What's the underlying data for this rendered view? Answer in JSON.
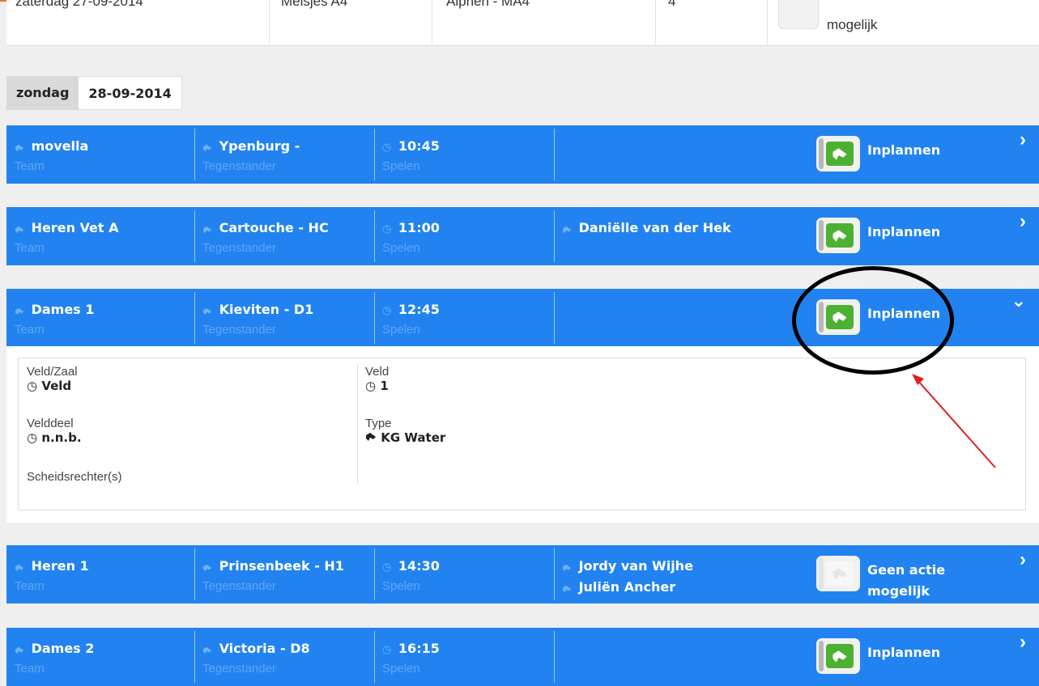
{
  "previous_row": {
    "date": "zaterdag 27-09-2014",
    "team": "Meisjes A4",
    "opponent": "Alphen - MA4",
    "count": "4",
    "status": "mogelijk"
  },
  "date_tab": {
    "day": "zondag",
    "date": "28-09-2014"
  },
  "labels": {
    "team": "Team",
    "opponent": "Tegenstander",
    "time": "Spelen"
  },
  "matches": [
    {
      "team": "movella",
      "opponent": "Ypenburg -",
      "time": "10:45",
      "referee": "",
      "referee2": "",
      "action": "Inplannen",
      "action2": "",
      "enabled": true,
      "expanded": false
    },
    {
      "team": "Heren Vet A",
      "opponent": "Cartouche - HC",
      "time": "11:00",
      "referee": "Daniëlle van der Hek",
      "referee2": "",
      "action": "Inplannen",
      "action2": "",
      "enabled": true,
      "expanded": false
    },
    {
      "team": "Dames 1",
      "opponent": "Kieviten - D1",
      "time": "12:45",
      "referee": "",
      "referee2": "",
      "action": "Inplannen",
      "action2": "",
      "enabled": true,
      "expanded": true
    },
    {
      "team": "Heren 1",
      "opponent": "Prinsenbeek - H1",
      "time": "14:30",
      "referee": "Jordy van Wijhe",
      "referee2": "Juliën Ancher",
      "action": "Geen actie",
      "action2": "mogelijk",
      "enabled": false,
      "expanded": false
    },
    {
      "team": "Dames 2",
      "opponent": "Victoria - D8",
      "time": "16:15",
      "referee": "",
      "referee2": "",
      "action": "Inplannen",
      "action2": "",
      "enabled": true,
      "expanded": false
    }
  ],
  "details": {
    "veld_zaal_label": "Veld/Zaal",
    "veld_zaal_value": "Veld",
    "velddeel_label": "Velddeel",
    "velddeel_value": "n.n.b.",
    "scheidsrechters_label": "Scheidsrechter(s)",
    "veld_label": "Veld",
    "veld_value": "1",
    "type_label": "Type",
    "type_value": "KG Water"
  },
  "icons": {
    "team": "whistle-icon",
    "opponent": "whistle-icon",
    "time": "clock-icon",
    "referee": "whistle-icon",
    "action": "whistle-icon",
    "expand": "chevron-right-icon",
    "collapse": "chevron-down-icon"
  },
  "colors": {
    "row_blue": "#2283f0",
    "label_blue": "#5ea6f5",
    "action_green": "#4cb131",
    "top_accent": "#e87722",
    "annotation": "#000000",
    "arrow": "#e02020"
  }
}
